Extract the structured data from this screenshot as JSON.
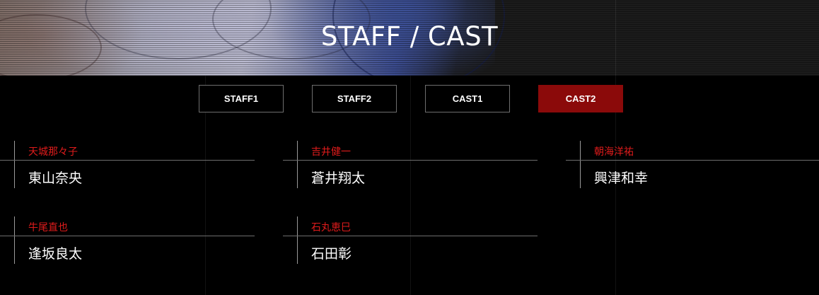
{
  "header": {
    "title": "STAFF / CAST"
  },
  "tabs": [
    {
      "label": "STAFF1",
      "active": false
    },
    {
      "label": "STAFF2",
      "active": false
    },
    {
      "label": "CAST1",
      "active": false
    },
    {
      "label": "CAST2",
      "active": true
    }
  ],
  "cast": [
    {
      "role": "天城那々子",
      "actor": "東山奈央"
    },
    {
      "role": "吉井健一",
      "actor": "蒼井翔太"
    },
    {
      "role": "朝海洋祐",
      "actor": "興津和幸"
    },
    {
      "role": "牛尾直也",
      "actor": "逢坂良太"
    },
    {
      "role": "石丸恵巳",
      "actor": "石田彰"
    }
  ],
  "colors": {
    "background": "#000000",
    "accent_red": "#e01b1b",
    "active_tab": "#8b0a0a",
    "tab_border": "#6e6e6e"
  }
}
